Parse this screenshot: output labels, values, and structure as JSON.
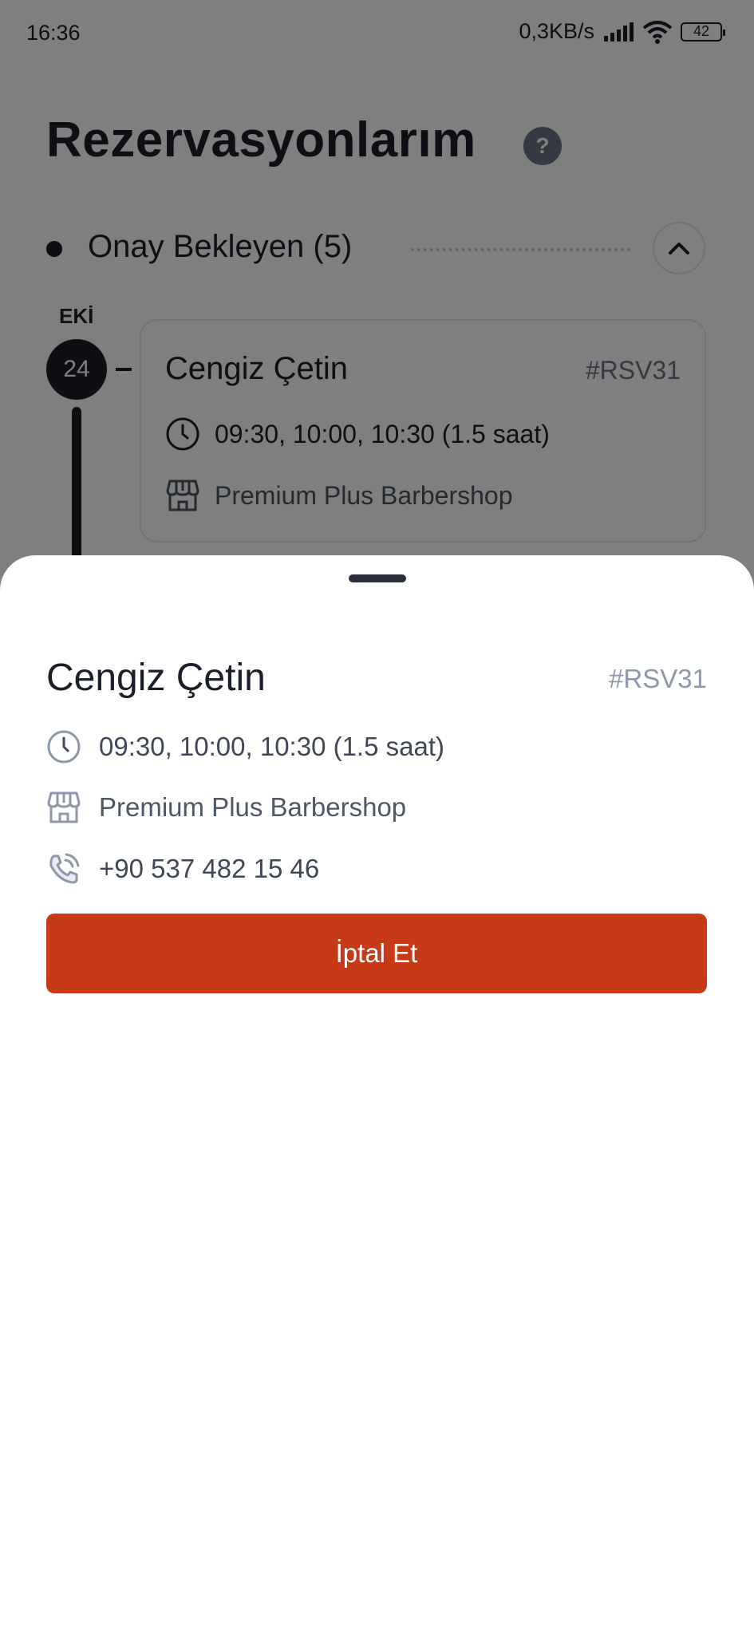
{
  "status_bar": {
    "time": "16:36",
    "net_speed": "0,3KB/s",
    "battery": "42"
  },
  "page": {
    "title": "Rezervasyonlarım",
    "help_icon": "?"
  },
  "section": {
    "title": "Onay Bekleyen (5)"
  },
  "timeline": {
    "month": "EKİ",
    "day": "24"
  },
  "background_card": {
    "name": "Cengiz Çetin",
    "code": "#RSV31",
    "time": "09:30, 10:00, 10:30 (1.5 saat)",
    "shop": "Premium Plus Barbershop"
  },
  "sheet": {
    "name": "Cengiz Çetin",
    "code": "#RSV31",
    "time": "09:30, 10:00, 10:30 (1.5 saat)",
    "shop": "Premium Plus Barbershop",
    "phone": "+90 537 482 15 46",
    "cancel_label": "İptal Et"
  },
  "colors": {
    "primary_dark": "#1b1f29",
    "cancel": "#c73a17",
    "muted": "#8e98a8"
  },
  "icons": {
    "clock": "clock-icon",
    "store": "store-icon",
    "phone": "phone-icon",
    "chevron": "chevron-up-icon"
  }
}
